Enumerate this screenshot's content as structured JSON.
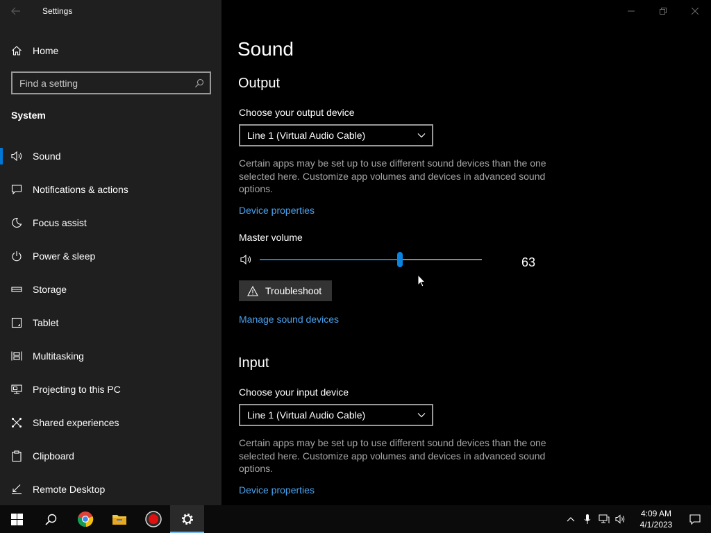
{
  "window": {
    "title": "Settings"
  },
  "sidebar": {
    "home_label": "Home",
    "search": {
      "placeholder": "Find a setting"
    },
    "section_title": "System",
    "items": [
      {
        "label": "Sound",
        "icon": "speaker-icon",
        "selected": true
      },
      {
        "label": "Notifications & actions",
        "icon": "notification-icon",
        "selected": false
      },
      {
        "label": "Focus assist",
        "icon": "moon-icon",
        "selected": false
      },
      {
        "label": "Power & sleep",
        "icon": "power-icon",
        "selected": false
      },
      {
        "label": "Storage",
        "icon": "storage-icon",
        "selected": false
      },
      {
        "label": "Tablet",
        "icon": "tablet-icon",
        "selected": false
      },
      {
        "label": "Multitasking",
        "icon": "multitasking-icon",
        "selected": false
      },
      {
        "label": "Projecting to this PC",
        "icon": "projecting-icon",
        "selected": false
      },
      {
        "label": "Shared experiences",
        "icon": "shared-experiences-icon",
        "selected": false
      },
      {
        "label": "Clipboard",
        "icon": "clipboard-icon",
        "selected": false
      },
      {
        "label": "Remote Desktop",
        "icon": "remote-desktop-icon",
        "selected": false
      }
    ]
  },
  "main": {
    "page_title": "Sound",
    "output": {
      "heading": "Output",
      "device_label": "Choose your output device",
      "device_value": "Line 1 (Virtual Audio Cable)",
      "description": "Certain apps may be set up to use different sound devices than the one selected here. Customize app volumes and devices in advanced sound options.",
      "device_properties_link": "Device properties",
      "master_volume_label": "Master volume",
      "volume": 63,
      "volume_text": "63",
      "troubleshoot_label": "Troubleshoot",
      "manage_devices_link": "Manage sound devices"
    },
    "input": {
      "heading": "Input",
      "device_label": "Choose your input device",
      "device_value": "Line 1 (Virtual Audio Cable)",
      "description": "Certain apps may be set up to use different sound devices than the one selected here. Customize app volumes and devices in advanced sound options.",
      "device_properties_link": "Device properties"
    }
  },
  "taskbar": {
    "time": "4:09 AM",
    "date": "4/1/2023"
  },
  "colors": {
    "accent": "#0078d7",
    "link": "#4aa3f0",
    "sidebar_bg": "#1f1f1f",
    "content_bg": "#000000"
  }
}
